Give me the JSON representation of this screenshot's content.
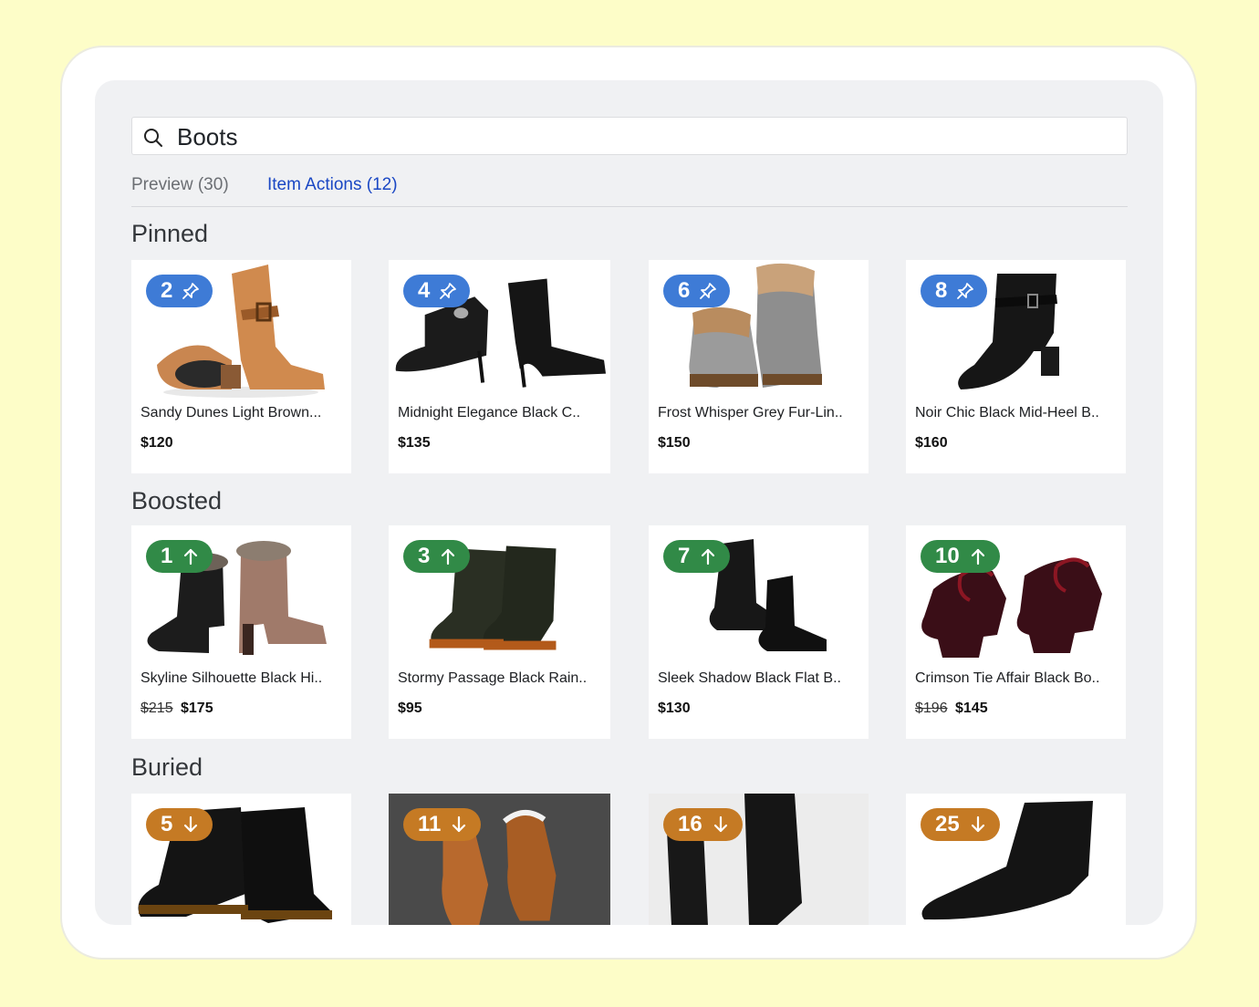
{
  "search": {
    "query": "Boots"
  },
  "tabs": [
    {
      "label": "Preview (30)"
    },
    {
      "label": "Item Actions (12)"
    }
  ],
  "sections": {
    "pinned": {
      "title": "Pinned",
      "items": [
        {
          "rank": "2",
          "name": "Sandy Dunes Light Brown...",
          "price": "$120"
        },
        {
          "rank": "4",
          "name": "Midnight Elegance Black C..",
          "price": "$135"
        },
        {
          "rank": "6",
          "name": "Frost Whisper Grey Fur-Lin..",
          "price": "$150"
        },
        {
          "rank": "8",
          "name": "Noir Chic Black Mid-Heel B..",
          "price": "$160"
        }
      ]
    },
    "boosted": {
      "title": "Boosted",
      "items": [
        {
          "rank": "1",
          "name": "Skyline Silhouette Black Hi..",
          "old_price": "$215",
          "price": "$175"
        },
        {
          "rank": "3",
          "name": "Stormy Passage Black Rain..",
          "price": "$95"
        },
        {
          "rank": "7",
          "name": "Sleek Shadow Black Flat B..",
          "price": "$130"
        },
        {
          "rank": "10",
          "name": "Crimson Tie Affair Black Bo..",
          "old_price": "$196",
          "price": "$145"
        }
      ]
    },
    "buried": {
      "title": "Buried",
      "items": [
        {
          "rank": "5"
        },
        {
          "rank": "11"
        },
        {
          "rank": "16"
        },
        {
          "rank": "25"
        }
      ]
    }
  },
  "colors": {
    "pinned_badge": "#3e7bd6",
    "boosted_badge": "#318a47",
    "buried_badge": "#c57a24",
    "active_tab": "#1a47c4"
  }
}
